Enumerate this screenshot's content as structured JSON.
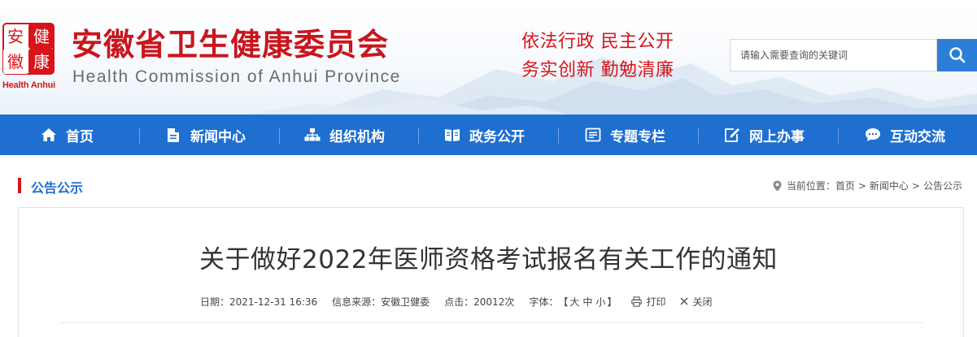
{
  "header": {
    "logo": {
      "seal_chars": [
        "安",
        "健",
        "徽",
        "康"
      ],
      "english": "Health Anhui"
    },
    "title": "安徽省卫生健康委员会",
    "subtitle": "Health Commission of Anhui Province",
    "slogan_line1": "依法行政  民主公开",
    "slogan_line2": "务实创新  勤勉清廉",
    "search": {
      "placeholder": "请输入需要查询的关键词",
      "button_icon": "search-icon"
    }
  },
  "nav": {
    "items": [
      {
        "label": "首页",
        "icon": "home-icon"
      },
      {
        "label": "新闻中心",
        "icon": "document-icon"
      },
      {
        "label": "组织机构",
        "icon": "org-chart-icon"
      },
      {
        "label": "政务公开",
        "icon": "book-icon"
      },
      {
        "label": "专题专栏",
        "icon": "list-box-icon"
      },
      {
        "label": "网上办事",
        "icon": "edit-icon"
      },
      {
        "label": "互动交流",
        "icon": "chat-bubble-icon"
      }
    ]
  },
  "section": {
    "title": "公告公示",
    "breadcrumb": {
      "prefix": "当前位置：",
      "items": [
        "首页",
        "新闻中心",
        "公告公示"
      ],
      "separator": ">"
    }
  },
  "article": {
    "title": "关于做好2022年医师资格考试报名有关工作的通知",
    "meta": {
      "date": "日期：2021-12-31 16:36",
      "source": "信息来源：安徽卫健委",
      "hits": "点击：20012次",
      "font_label": "字体：",
      "font_open": "【",
      "font_large": "大",
      "font_medium": "中",
      "font_small": "小",
      "font_close": "】",
      "print": "打印",
      "close": "关闭"
    }
  },
  "colors": {
    "brand_red": "#c8161d",
    "nav_blue": "#1e6fd0",
    "search_blue": "#2c7fd6",
    "section_blue": "#1e6fd0"
  }
}
